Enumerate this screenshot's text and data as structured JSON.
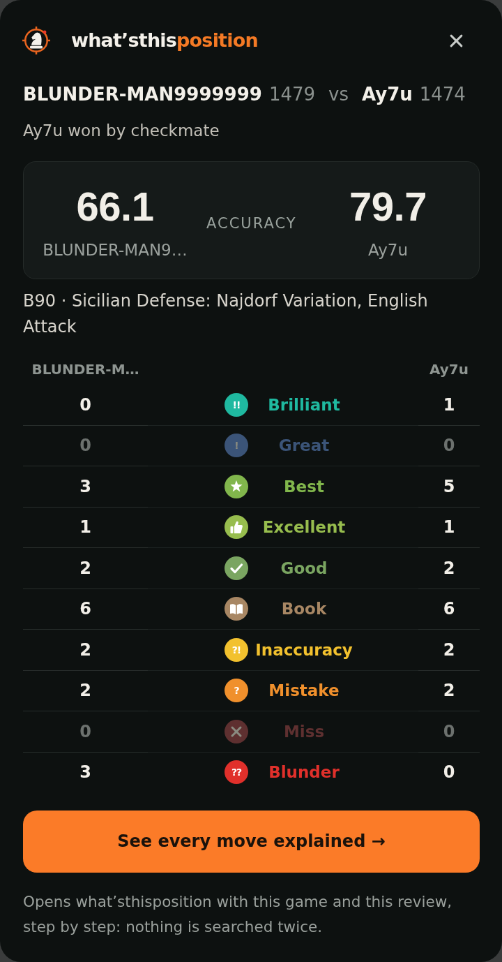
{
  "header": {
    "brand": {
      "main": "what’sthis",
      "accent": "position"
    }
  },
  "players": [
    {
      "name": "BLUNDER-MAN9999999",
      "rating": "1479"
    },
    {
      "name": "Ay7u",
      "rating": "1474"
    }
  ],
  "versus": "vs",
  "result": "Ay7u won by checkmate",
  "accuracy": {
    "label": "ACCURACY",
    "players": [
      {
        "score": "66.1",
        "name": "BLUNDER-MAN9…"
      },
      {
        "score": "79.7",
        "name": "Ay7u"
      }
    ]
  },
  "opening": "B90 · Sicilian Defense: Najdorf Variation, English Attack",
  "summary_table": {
    "columns": [
      "BLUNDER-M…",
      "Ay7u"
    ],
    "rows": [
      {
        "kind": "symbol",
        "symbol": "!!",
        "label": "Brilliant",
        "color": "#1fb9a0",
        "dimmed": false,
        "counts": [
          "0",
          "1"
        ]
      },
      {
        "kind": "symbol",
        "symbol": "!",
        "label": "Great",
        "color": "#3b5478",
        "dimmed": true,
        "counts": [
          "0",
          "0"
        ]
      },
      {
        "kind": "star",
        "label": "Best",
        "color": "#81b64c",
        "dimmed": false,
        "counts": [
          "3",
          "5"
        ]
      },
      {
        "kind": "thumbs_up",
        "label": "Excellent",
        "color": "#97bd4e",
        "dimmed": false,
        "counts": [
          "1",
          "1"
        ]
      },
      {
        "kind": "check",
        "label": "Good",
        "color": "#7aa561",
        "dimmed": false,
        "counts": [
          "2",
          "2"
        ]
      },
      {
        "kind": "book",
        "label": "Book",
        "color": "#a88764",
        "dimmed": false,
        "counts": [
          "6",
          "6"
        ]
      },
      {
        "kind": "symbol",
        "symbol": "?!",
        "label": "Inaccuracy",
        "color": "#f2c12e",
        "dimmed": false,
        "counts": [
          "2",
          "2"
        ]
      },
      {
        "kind": "symbol",
        "symbol": "?",
        "label": "Mistake",
        "color": "#f0902c",
        "dimmed": false,
        "counts": [
          "2",
          "2"
        ]
      },
      {
        "kind": "cross",
        "label": "Miss",
        "color": "#5e3030",
        "dimmed": true,
        "counts": [
          "0",
          "0"
        ]
      },
      {
        "kind": "symbol",
        "symbol": "??",
        "label": "Blunder",
        "color": "#e0302b",
        "dimmed": false,
        "counts": [
          "3",
          "0"
        ]
      }
    ]
  },
  "action_button": {
    "label": "See every move explained →"
  },
  "footnote": "Opens what’sthisposition with this game and this review, step by step: nothing is searched twice."
}
